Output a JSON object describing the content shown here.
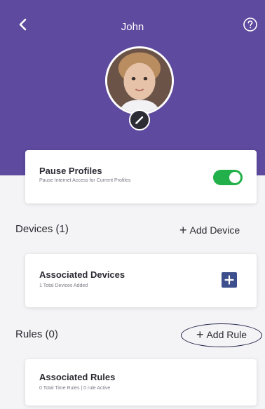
{
  "header": {
    "title": "John",
    "back_icon": "chevron-left-icon",
    "help_icon": "question-circle-icon",
    "edit_icon": "pencil-icon",
    "background": "#5e4a9e"
  },
  "pause_card": {
    "title": "Pause Profiles",
    "subtitle": "Pause Internet Access for Current Profiles",
    "toggle_on": true,
    "toggle_color": "#22b04a"
  },
  "devices": {
    "label": "Devices (1)",
    "add_label": "Add Device",
    "card_title": "Associated Devices",
    "card_subtitle": "1 Total Devices Added",
    "add_icon": "plus-square-icon"
  },
  "rules": {
    "label": "Rules (0)",
    "add_label": "Add Rule",
    "card_title": "Associated Rules",
    "card_subtitle": "0 Total Time Rules | 0 rule Active"
  }
}
